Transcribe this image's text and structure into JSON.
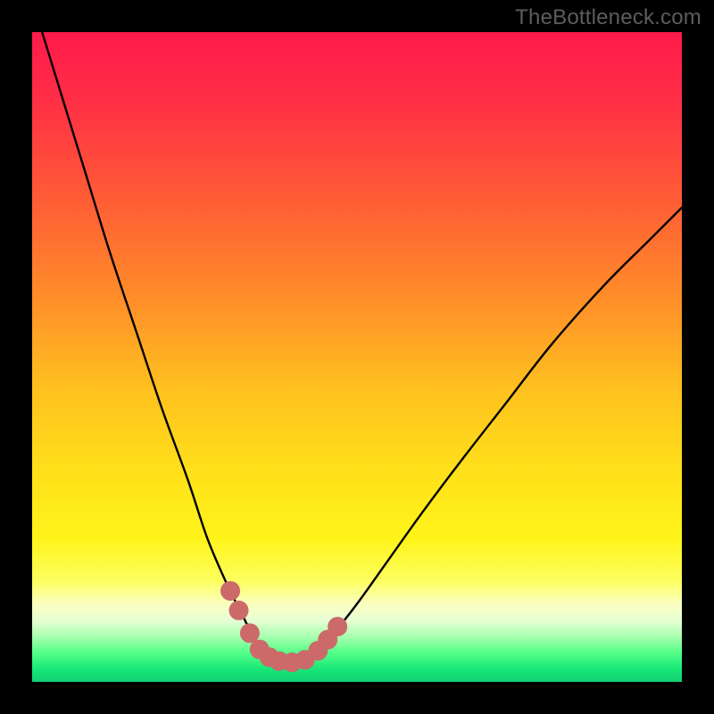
{
  "watermark": "TheBottleneck.com",
  "colors": {
    "frame": "#000000",
    "curve": "#000000",
    "marker_fill": "#cc6a6a",
    "marker_stroke": "#cc6a6a",
    "gradient_stops": [
      {
        "offset": 0.0,
        "color": "#ff1a4b"
      },
      {
        "offset": 0.1,
        "color": "#ff2d46"
      },
      {
        "offset": 0.25,
        "color": "#ff5a36"
      },
      {
        "offset": 0.4,
        "color": "#ff8a2a"
      },
      {
        "offset": 0.55,
        "color": "#ffc11f"
      },
      {
        "offset": 0.68,
        "color": "#ffe11a"
      },
      {
        "offset": 0.78,
        "color": "#fff41a"
      },
      {
        "offset": 0.845,
        "color": "#fcff60"
      },
      {
        "offset": 0.88,
        "color": "#fbffc0"
      },
      {
        "offset": 0.905,
        "color": "#e8ffd4"
      },
      {
        "offset": 0.93,
        "color": "#a9ffb0"
      },
      {
        "offset": 0.955,
        "color": "#55ff88"
      },
      {
        "offset": 0.98,
        "color": "#18e878"
      },
      {
        "offset": 1.0,
        "color": "#10d072"
      }
    ]
  },
  "chart_data": {
    "type": "line",
    "title": "",
    "xlabel": "",
    "ylabel": "",
    "xlim": [
      0,
      100
    ],
    "ylim": [
      0,
      100
    ],
    "curve": {
      "x": [
        0,
        4,
        8,
        12,
        16,
        20,
        24,
        27,
        30,
        32.5,
        34,
        35.5,
        37,
        39,
        41,
        43.5,
        46,
        50,
        55,
        60,
        66,
        73,
        80,
        88,
        95,
        100
      ],
      "y": [
        105,
        92,
        79,
        66,
        54,
        42,
        31,
        22,
        15,
        10,
        7,
        5,
        3.5,
        3,
        3.2,
        4.5,
        7,
        12,
        19,
        26,
        34,
        43,
        52,
        61,
        68,
        73
      ]
    },
    "markers": {
      "x": [
        30.5,
        31.8,
        33.5,
        35.0,
        36.5,
        38.0,
        40.0,
        42.0,
        44.0,
        45.5,
        47.0
      ],
      "y": [
        14.0,
        11.0,
        7.5,
        5.0,
        3.8,
        3.2,
        3.0,
        3.4,
        4.8,
        6.5,
        8.5
      ]
    }
  }
}
